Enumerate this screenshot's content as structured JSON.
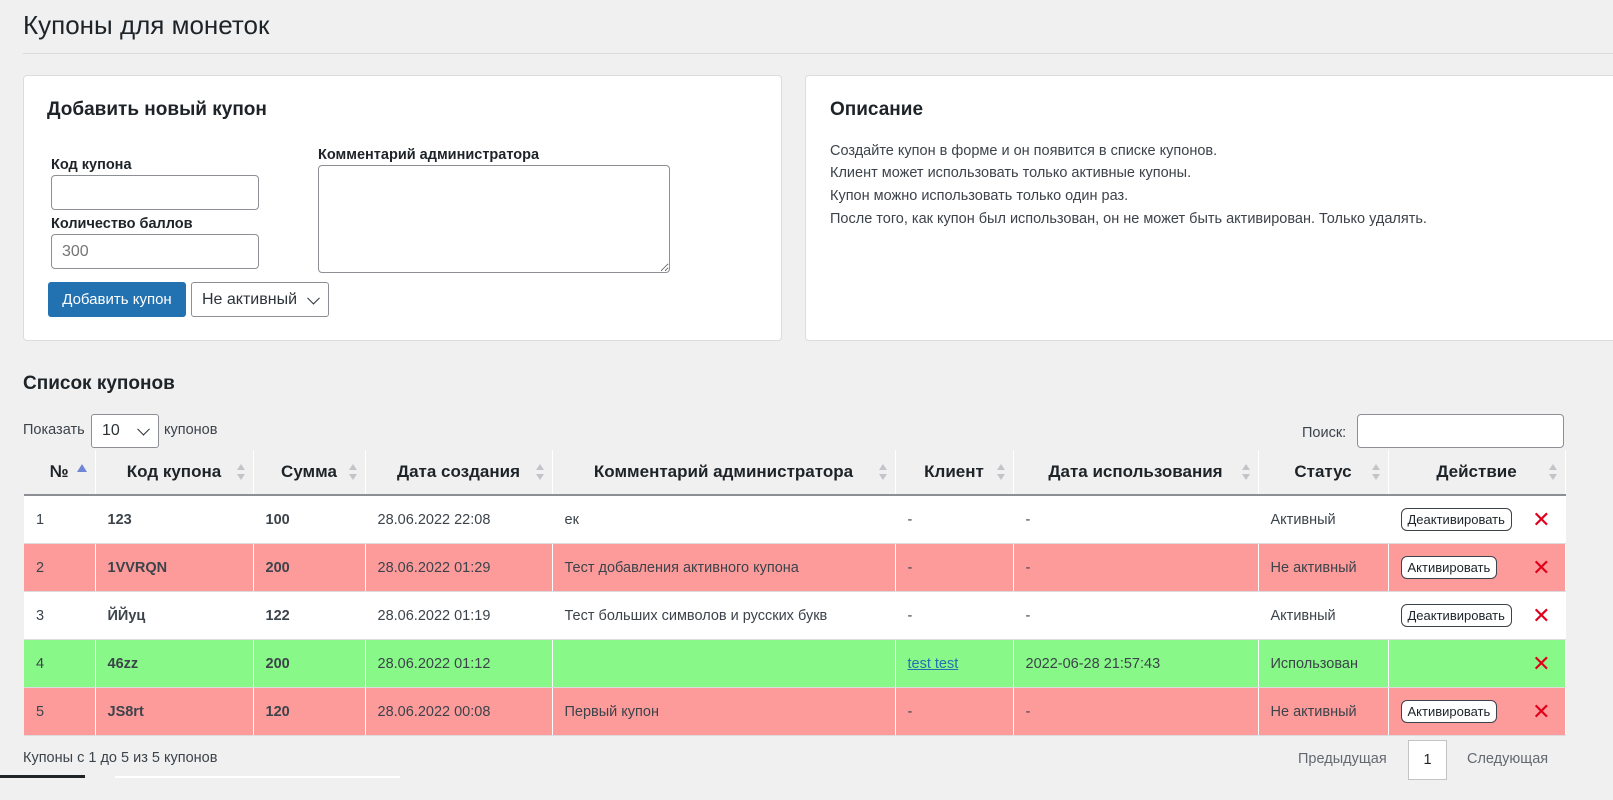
{
  "page": {
    "title": "Купоны для монеток"
  },
  "add_form": {
    "title": "Добавить новый купон",
    "code_label": "Код купона",
    "code_value": "",
    "points_label": "Количество баллов",
    "points_placeholder": "300",
    "comment_label": "Комментарий администратора",
    "comment_value": "",
    "submit_label": "Добавить купон",
    "status_select": "Не активный"
  },
  "description": {
    "title": "Описание",
    "lines": [
      "Создайте купон в форме и он появится в списке купонов.",
      "Клиент может использовать только активные купоны.",
      "Купон можно использовать только один раз.",
      "После того, как купон был использован, он не может быть активирован. Только удалять."
    ]
  },
  "list": {
    "title": "Список купонов",
    "show_label": "Показать",
    "page_size": "10",
    "show_suffix": "купонов",
    "search_label": "Поиск:",
    "search_value": "",
    "columns": [
      "№",
      "Код купона",
      "Сумма",
      "Дата создания",
      "Комментарий администратора",
      "Клиент",
      "Дата использования",
      "Статус",
      "Действие"
    ],
    "rows": [
      {
        "num": "1",
        "code": "123",
        "sum": "100",
        "created": "28.06.2022 22:08",
        "comment": "ек",
        "client": "-",
        "used": "-",
        "status": "Активный",
        "action": "Деактивировать",
        "color": "white"
      },
      {
        "num": "2",
        "code": "1VVRQN",
        "sum": "200",
        "created": "28.06.2022 01:29",
        "comment": "Тест добавления активного купона",
        "client": "-",
        "used": "-",
        "status": "Не активный",
        "action": "Активировать",
        "color": "red"
      },
      {
        "num": "3",
        "code": "ЙЙуц",
        "sum": "122",
        "created": "28.06.2022 01:19",
        "comment": "Тест больших символов и русских букв",
        "client": "-",
        "used": "-",
        "status": "Активный",
        "action": "Деактивировать",
        "color": "white"
      },
      {
        "num": "4",
        "code": "46zz",
        "sum": "200",
        "created": "28.06.2022 01:12",
        "comment": "",
        "client": "test test",
        "used": "2022-06-28 21:57:43",
        "status": "Использован",
        "action": "",
        "color": "green"
      },
      {
        "num": "5",
        "code": "JS8rt",
        "sum": "120",
        "created": "28.06.2022 00:08",
        "comment": "Первый купон",
        "client": "-",
        "used": "-",
        "status": "Не активный",
        "action": "Активировать",
        "color": "red"
      }
    ],
    "delete_icon": "close-x-icon",
    "footer_info": "Купоны с 1 до 5 из 5 купонов",
    "prev_label": "Предыдущая",
    "current_page": "1",
    "next_label": "Следующая"
  },
  "colors": {
    "primary": "#2271b1",
    "row_red": "#fd9b9b",
    "row_green": "#88f888",
    "delete": "#e0001b"
  }
}
